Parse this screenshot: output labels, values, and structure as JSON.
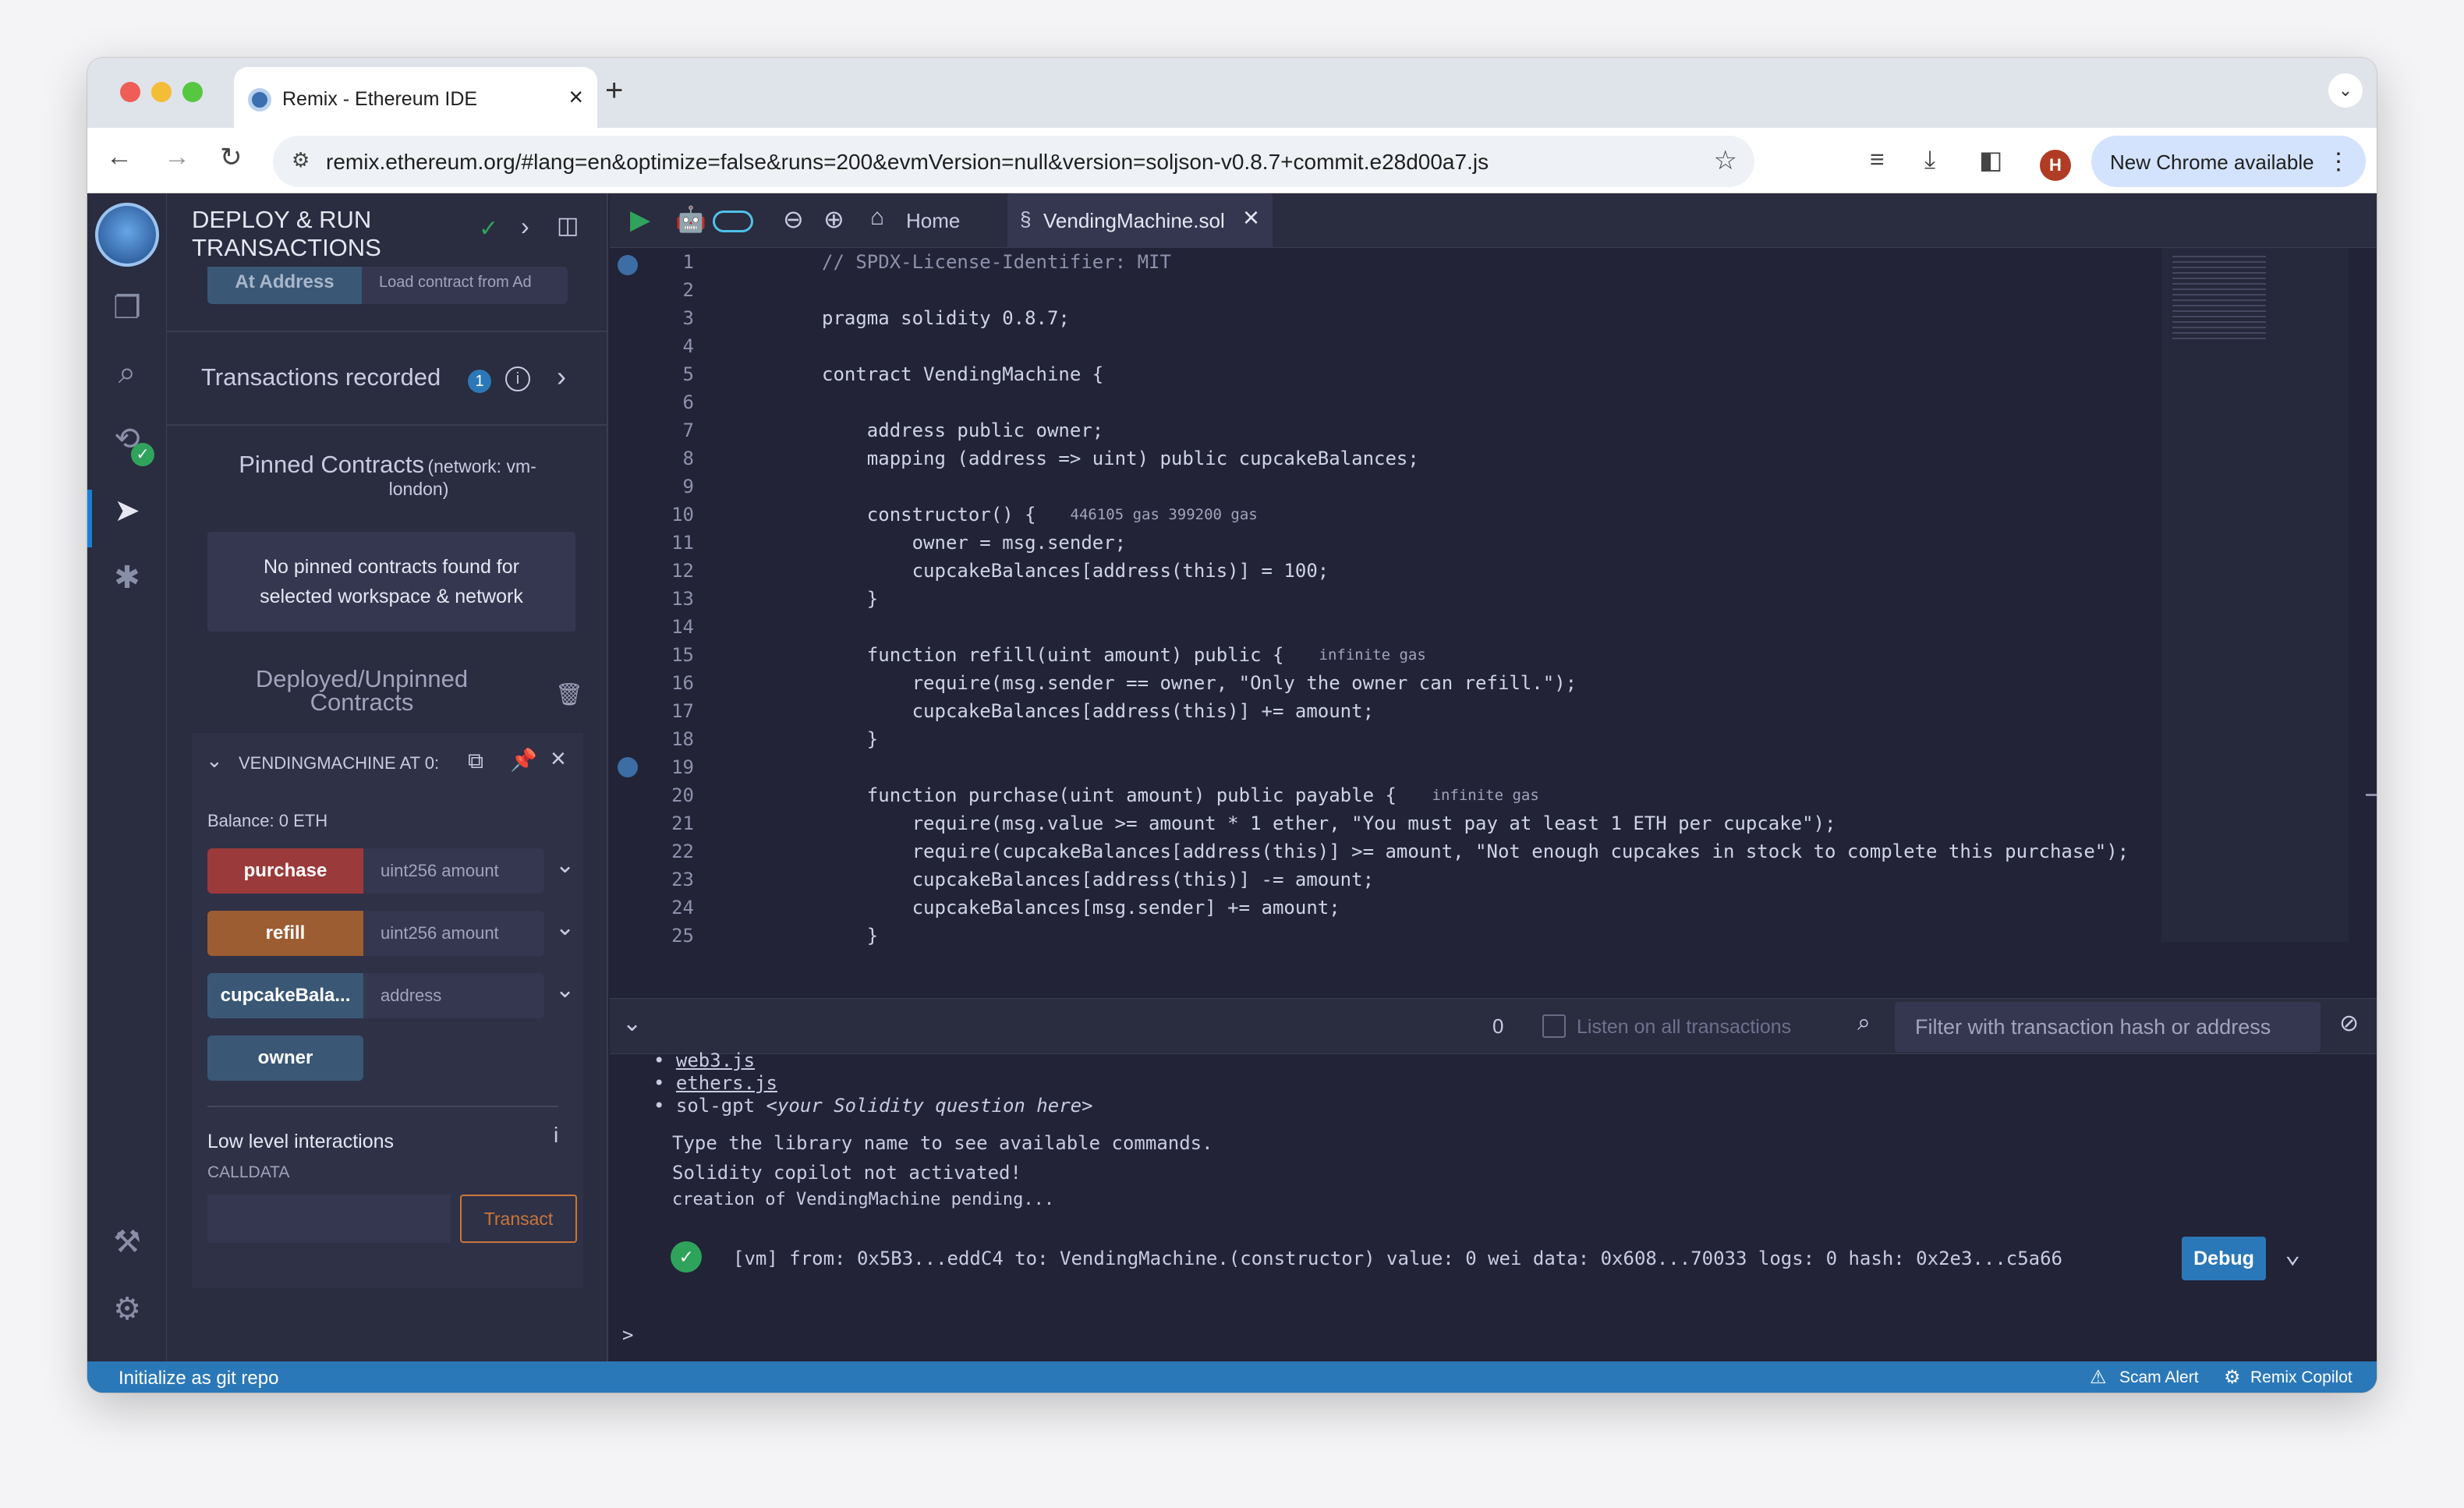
{
  "browser": {
    "tab_title": "Remix - Ethereum IDE",
    "url": "remix.ethereum.org/#lang=en&optimize=false&runs=200&evmVersion=null&version=soljson-v0.8.7+commit.e28d00a7.js",
    "new_chrome": "New Chrome available",
    "avatar_initial": "H"
  },
  "panel": {
    "title_line1": "DEPLOY & RUN",
    "title_line2": "TRANSACTIONS",
    "at_address_label": "At Address",
    "load_contract_placeholder": "Load contract from Ad",
    "transactions_recorded": "Transactions recorded",
    "transactions_count": "1",
    "pinned_title": "Pinned Contracts",
    "pinned_network": "(network: vm-",
    "pinned_network2": "london)",
    "no_pinned_line1": "No pinned contracts found for",
    "no_pinned_line2": "selected workspace & network",
    "deployed_line1": "Deployed/Unpinned",
    "deployed_line2": "Contracts",
    "instance_name": "VENDINGMACHINE AT 0:",
    "balance": "Balance: 0 ETH",
    "functions": [
      {
        "label": "purchase",
        "placeholder": "uint256 amount",
        "color": "#9b3a3a"
      },
      {
        "label": "refill",
        "placeholder": "uint256 amount",
        "color": "#9c5d32"
      },
      {
        "label": "cupcakeBala...",
        "placeholder": "address",
        "color": "#3a5776"
      }
    ],
    "owner_label": "owner",
    "low_level": "Low level interactions",
    "calldata": "CALLDATA",
    "transact": "Transact"
  },
  "editor": {
    "home_tab": "Home",
    "file_tab": "VendingMachine.sol",
    "lines": [
      {
        "n": "1",
        "text": "// SPDX-License-Identifier: MIT"
      },
      {
        "n": "2",
        "text": ""
      },
      {
        "n": "3",
        "text": "pragma solidity 0.8.7;"
      },
      {
        "n": "4",
        "text": ""
      },
      {
        "n": "5",
        "text": "contract VendingMachine {"
      },
      {
        "n": "6",
        "text": ""
      },
      {
        "n": "7",
        "text": "    address public owner;"
      },
      {
        "n": "8",
        "text": "    mapping (address => uint) public cupcakeBalances;"
      },
      {
        "n": "9",
        "text": ""
      },
      {
        "n": "10",
        "text": "    constructor() {"
      },
      {
        "n": "11",
        "text": "        owner = msg.sender;"
      },
      {
        "n": "12",
        "text": "        cupcakeBalances[address(this)] = 100;"
      },
      {
        "n": "13",
        "text": "    }"
      },
      {
        "n": "14",
        "text": ""
      },
      {
        "n": "15",
        "text": "    function refill(uint amount) public {"
      },
      {
        "n": "16",
        "text": "        require(msg.sender == owner, \"Only the owner can refill.\");"
      },
      {
        "n": "17",
        "text": "        cupcakeBalances[address(this)] += amount;"
      },
      {
        "n": "18",
        "text": "    }"
      },
      {
        "n": "19",
        "text": ""
      },
      {
        "n": "20",
        "text": "    function purchase(uint amount) public payable {"
      },
      {
        "n": "21",
        "text": "        require(msg.value >= amount * 1 ether, \"You must pay at least 1 ETH per cupcake\");"
      },
      {
        "n": "22",
        "text": "        require(cupcakeBalances[address(this)] >= amount, \"Not enough cupcakes in stock to complete this purchase\");"
      },
      {
        "n": "23",
        "text": "        cupcakeBalances[address(this)] -= amount;"
      },
      {
        "n": "24",
        "text": "        cupcakeBalances[msg.sender] += amount;"
      },
      {
        "n": "25",
        "text": "    }"
      }
    ],
    "gas_hints": [
      {
        "line": 10,
        "text": "446105 gas 399200 gas"
      },
      {
        "line": 15,
        "text": "infinite gas"
      },
      {
        "line": 20,
        "text": "infinite gas"
      }
    ]
  },
  "terminal": {
    "count": "0",
    "listen_label": "Listen on all transactions",
    "filter_placeholder": "Filter with transaction hash or address",
    "lib_web3": "web3.js",
    "lib_ethers": "ethers.js",
    "sol_gpt": "sol-gpt",
    "sol_gpt_hint": "<your Solidity question here>",
    "msg1": "Type the library name to see available commands.",
    "msg2": "Solidity copilot not activated!",
    "msg3": "creation of VendingMachine pending...",
    "tx": "[vm] from: 0x5B3...eddC4 to: VendingMachine.(constructor) value: 0 wei data: 0x608...70033 logs: 0 hash: 0x2e3...c5a66",
    "debug": "Debug",
    "prompt": ">"
  },
  "status": {
    "git": "Initialize as git repo",
    "scam": "Scam Alert",
    "copilot": "Remix Copilot"
  }
}
